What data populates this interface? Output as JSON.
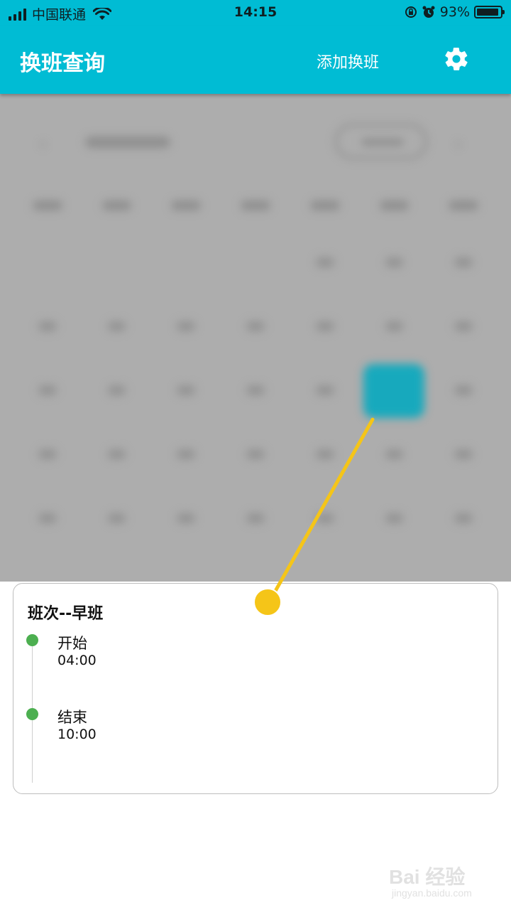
{
  "status_bar": {
    "carrier": "中国联通",
    "time": "14:15",
    "battery_percent": "93%",
    "battery_level": 0.93,
    "icons": [
      "signal-icon",
      "wifi-icon",
      "orientation-lock-icon",
      "alarm-icon",
      "battery-icon"
    ]
  },
  "app_bar": {
    "title": "换班查询",
    "add_label": "添加换班",
    "settings_icon": "gear-icon",
    "background": "#00bcd4"
  },
  "shift_card": {
    "title": "班次--早班",
    "events": [
      {
        "label": "开始",
        "time": "04:00"
      },
      {
        "label": "结束",
        "time": "10:00"
      }
    ],
    "dot_color": "#4caf50"
  },
  "annotation": {
    "color": "#f5c518"
  },
  "watermark": {
    "brand": "Bai 经验",
    "domain": "jingyan.baidu.com"
  }
}
